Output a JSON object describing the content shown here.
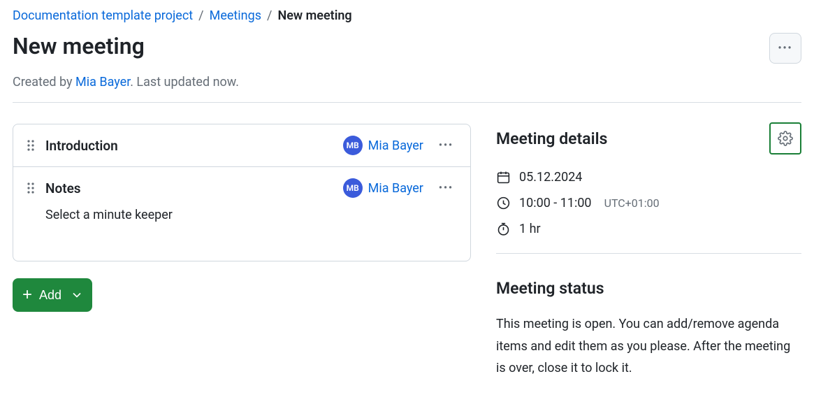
{
  "breadcrumb": {
    "items": [
      {
        "label": "Documentation template project"
      },
      {
        "label": "Meetings"
      }
    ],
    "current": "New meeting"
  },
  "page": {
    "title": "New meeting",
    "created_by_prefix": "Created by ",
    "author": "Mia Bayer",
    "updated_suffix": ". Last updated now."
  },
  "agenda": {
    "items": [
      {
        "title": "Introduction",
        "assignee_initials": "MB",
        "assignee_name": "Mia Bayer",
        "body": ""
      },
      {
        "title": "Notes",
        "assignee_initials": "MB",
        "assignee_name": "Mia Bayer",
        "body": "Select a minute keeper"
      }
    ]
  },
  "actions": {
    "add_label": "Add"
  },
  "details": {
    "heading": "Meeting details",
    "date": "05.12.2024",
    "time": "10:00 - 11:00",
    "tz": "UTC+01:00",
    "duration": "1 hr"
  },
  "status": {
    "heading": "Meeting status",
    "text": "This meeting is open. You can add/remove agenda items and edit them as you please. After the meeting is over, close it to lock it."
  }
}
